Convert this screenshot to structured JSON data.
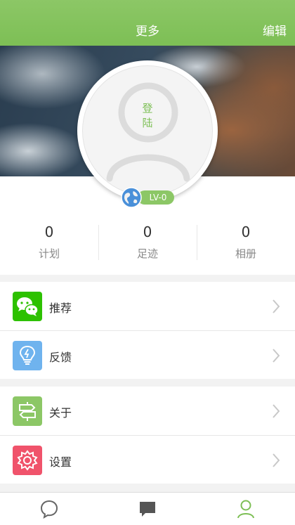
{
  "header": {
    "title": "更多",
    "edit_label": "编辑"
  },
  "profile": {
    "login_line1": "登",
    "login_line2": "陆",
    "level": "LV-0"
  },
  "stats": [
    {
      "value": "0",
      "label": "计划"
    },
    {
      "value": "0",
      "label": "足迹"
    },
    {
      "value": "0",
      "label": "相册"
    }
  ],
  "menu": {
    "recommend": "推荐",
    "feedback": "反馈",
    "about": "关于",
    "settings": "设置"
  },
  "colors": {
    "accent": "#7dbf55",
    "wechat": "#2dc100",
    "feedback": "#6fb3ee",
    "about": "#8cc766",
    "settings": "#f0536b"
  },
  "tabs": [
    {
      "icon": "chat-bubble-icon",
      "active": false
    },
    {
      "icon": "message-square-icon",
      "active": false
    },
    {
      "icon": "user-profile-icon",
      "active": true
    }
  ]
}
